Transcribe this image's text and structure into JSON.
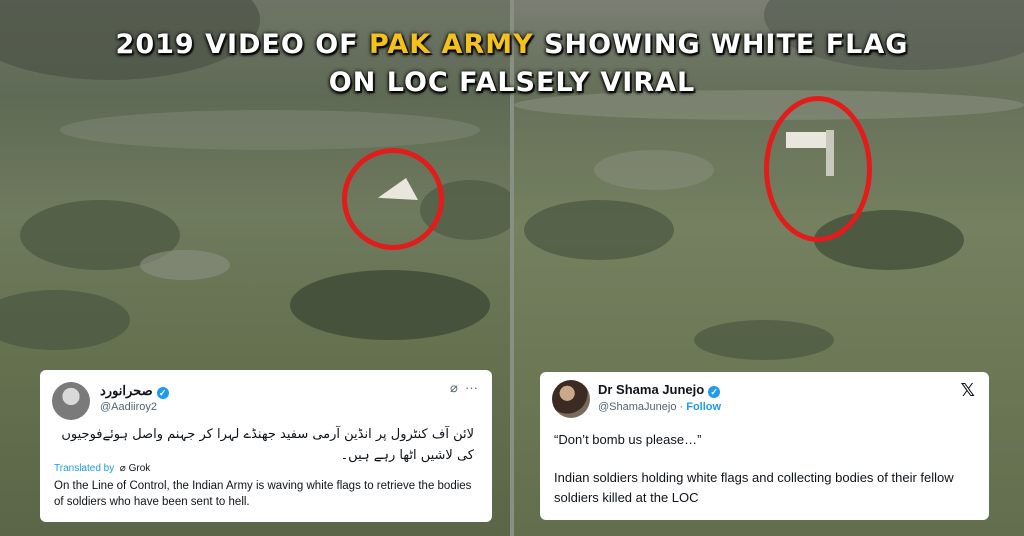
{
  "headline": {
    "line1_before": "2019 VIDEO OF ",
    "line1_highlight": "PAK ARMY",
    "line1_after": " SHOWING WHITE FLAG",
    "line2": "ON LOC FALSELY VIRAL"
  },
  "colors": {
    "highlight": "#f5c21b",
    "circle": "#e21b1b",
    "verified": "#1d9bf0"
  },
  "tweet_left": {
    "display_name": "صحرانورد",
    "handle": "@Aadiiroy2",
    "urdu_text": "لائن آف کنٹرول پر انڈین آرمی سفید جھنڈے لہرا کر جہنم واصل ہوئےفوجیوں کی لاشیں اٹھا رہے ہیں۔",
    "translated_by": "Translated by",
    "translator": "Grok",
    "translation": "On the Line of Control, the Indian Army is waving white flags to retrieve the bodies of soldiers who have been sent to hell.",
    "icons": [
      "grok-icon",
      "more-icon"
    ]
  },
  "tweet_right": {
    "display_name": "Dr Shama Junejo",
    "handle": "@ShamaJunejo",
    "separator": "·",
    "follow": "Follow",
    "quote": "“Don’t bomb us please…”",
    "body": "Indian soldiers holding white flags and collecting bodies of their fellow soldiers killed at the LOC",
    "icons": [
      "x-logo-icon"
    ]
  }
}
